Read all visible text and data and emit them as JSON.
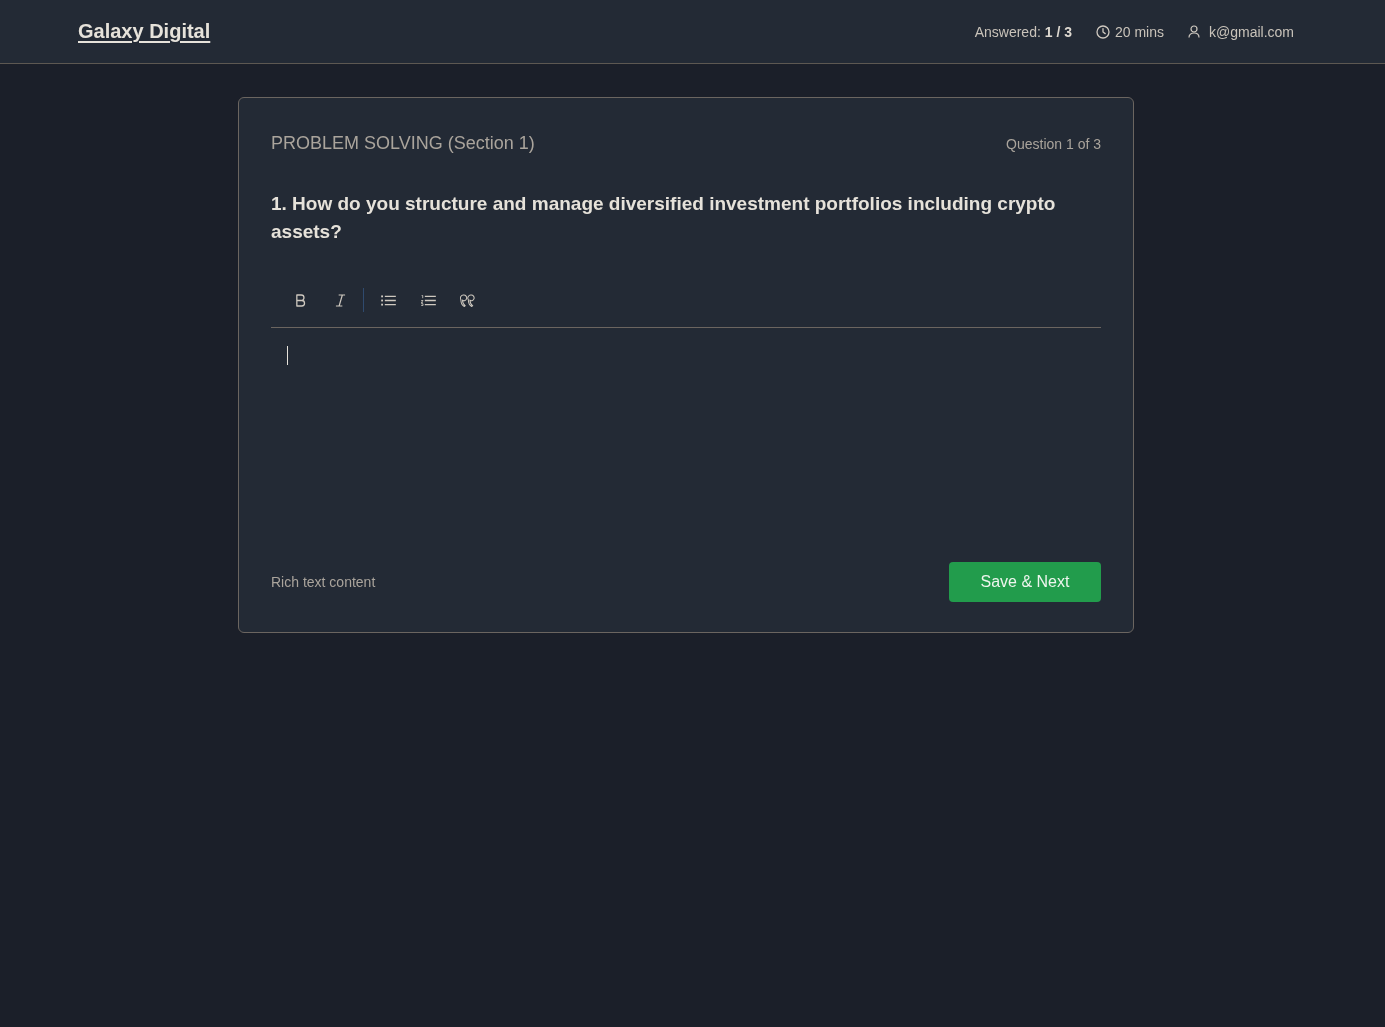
{
  "header": {
    "logo": "Galaxy Digital",
    "answered": "Answered: **1 / 3**",
    "timer": "20 mins",
    "user": "k@gmail.com"
  },
  "card": {
    "section": "PROBLEM SOLVING (Section 1)",
    "progress": "Question 1 of 3",
    "question": "1. How do you structure and manage diversified investment portfolios including crypto assets?",
    "toolbar": [
      {
        "kind": "bold"
      },
      {
        "kind": "italic"
      },
      {
        "kind": "separator"
      },
      {
        "kind": "bullet-list"
      },
      {
        "kind": "ordered-list"
      },
      {
        "kind": "quote"
      }
    ],
    "editor": {
      "focused": true
    },
    "caption": "Rich text content",
    "button": "Save & Next"
  }
}
